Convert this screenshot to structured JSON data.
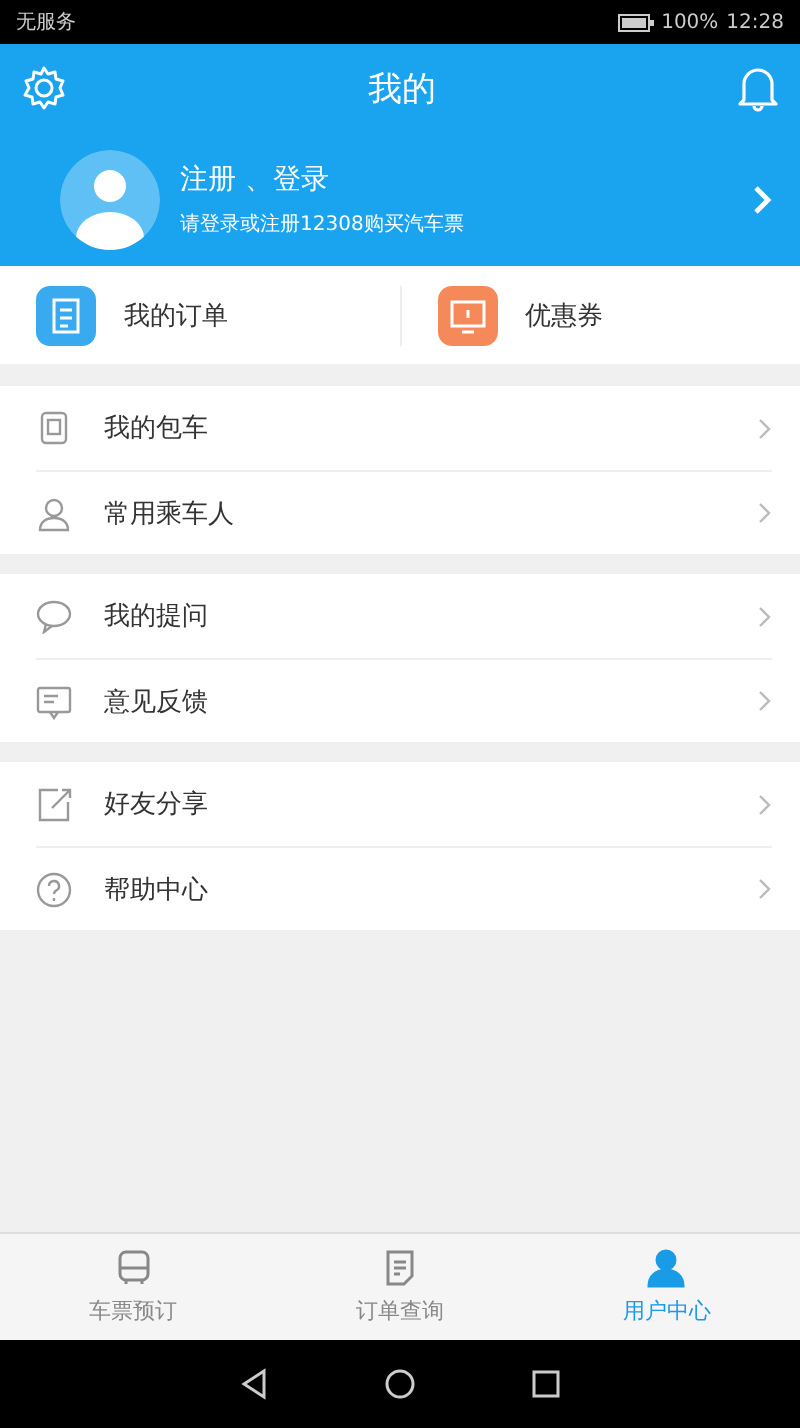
{
  "status_bar": {
    "carrier": "无服务",
    "battery": "100%",
    "time": "12:28"
  },
  "header": {
    "title": "我的"
  },
  "profile": {
    "name": "注册 、登录",
    "hint": "请登录或注册12308购买汽车票"
  },
  "quick_links": [
    {
      "label": "我的订单",
      "kind": "order",
      "color": "#3aaaf0"
    },
    {
      "label": "优惠券",
      "kind": "coupon",
      "color": "#f5895a"
    }
  ],
  "menu_groups": [
    [
      {
        "label": "我的包车",
        "kind": "phone"
      },
      {
        "label": "常用乘车人",
        "kind": "person"
      }
    ],
    [
      {
        "label": "我的提问",
        "kind": "bubble"
      },
      {
        "label": "意见反馈",
        "kind": "feedback"
      }
    ],
    [
      {
        "label": "好友分享",
        "kind": "share"
      },
      {
        "label": "帮助中心",
        "kind": "help"
      }
    ]
  ],
  "tabs": [
    {
      "label": "车票预订",
      "kind": "bus",
      "selected": false
    },
    {
      "label": "订单查询",
      "kind": "doc",
      "selected": false
    },
    {
      "label": "用户中心",
      "kind": "user",
      "selected": true
    }
  ]
}
